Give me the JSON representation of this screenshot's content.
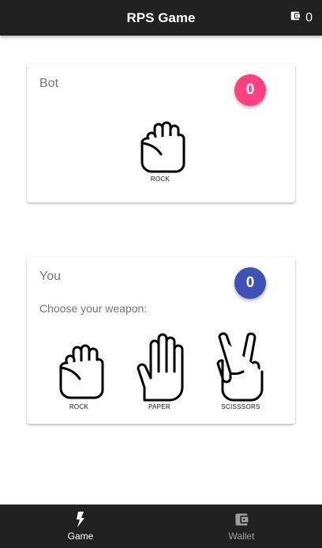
{
  "appbar": {
    "title": "RPS Game",
    "wallet_icon": "wallet-icon",
    "wallet_balance": "0"
  },
  "bot": {
    "title": "Bot",
    "score": "0",
    "badge_color": "#ff4081",
    "weapon": {
      "icon": "rock-hand-icon",
      "label": "ROCK"
    }
  },
  "you": {
    "title": "You",
    "score": "0",
    "badge_color": "#3f51b5",
    "prompt": "Choose your weapon:",
    "weapons": [
      {
        "icon": "rock-hand-icon",
        "label": "ROCK"
      },
      {
        "icon": "paper-hand-icon",
        "label": "PAPER"
      },
      {
        "icon": "scissors-hand-icon",
        "label": "SCISSSORS"
      }
    ]
  },
  "bottom_nav": {
    "items": [
      {
        "label": "Game",
        "icon": "lightning-icon",
        "active": true
      },
      {
        "label": "Wallet",
        "icon": "wallet-icon",
        "active": false
      }
    ]
  }
}
